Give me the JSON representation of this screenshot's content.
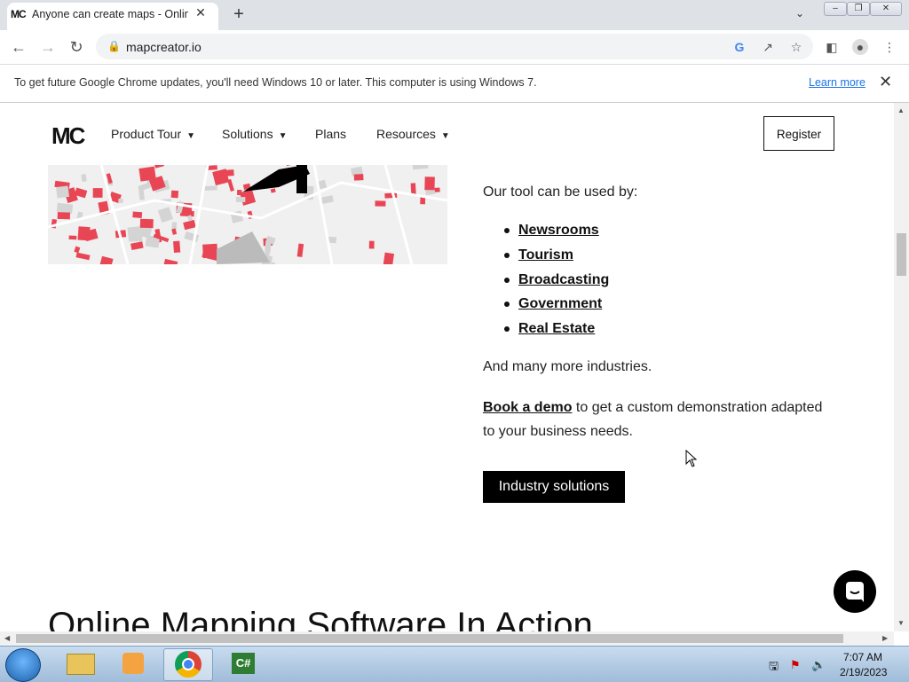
{
  "browser": {
    "tab_title": "Anyone can create maps - Online",
    "tab_favicon": "MC",
    "url": "mapcreator.io",
    "new_tab": "+",
    "tab_close": "✕"
  },
  "infobar": {
    "message": "To get future Google Chrome updates, you'll need Windows 10 or later. This computer is using Windows 7.",
    "link": "Learn more"
  },
  "site": {
    "logo": "MC",
    "nav": [
      "Product Tour",
      "Solutions",
      "Plans",
      "Resources"
    ],
    "register": "Register"
  },
  "content": {
    "intro": "Our tool can be used by:",
    "industries": [
      "Newsrooms",
      "Tourism",
      "Broadcasting",
      "Government",
      "Real Estate"
    ],
    "more": "And many more industries.",
    "demo_link": "Book a demo",
    "demo_text": " to get a custom demonstration adapted to your business needs.",
    "cta": "Industry solutions",
    "heading": "Online Mapping Software In Action"
  },
  "taskbar": {
    "time": "7:07 AM",
    "date": "2/19/2023"
  },
  "colors": {
    "map_red": "#e84655",
    "chrome_bg": "#dee1e6"
  }
}
